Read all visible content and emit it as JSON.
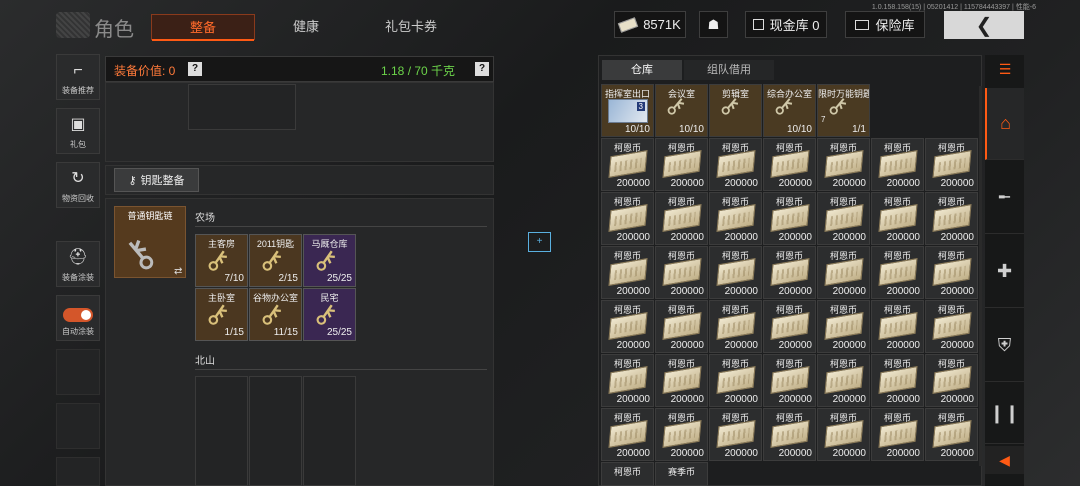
{
  "version": "1.0.158.158(15) | 05201412 | 115784443397 | 性能-6",
  "header": {
    "title": "角色",
    "tabs": [
      {
        "label": "整备",
        "active": true
      },
      {
        "label": "健康",
        "active": false
      },
      {
        "label": "礼包卡券",
        "active": false
      }
    ],
    "currency": "8571K",
    "cash_vault": "现金库 0",
    "safe_vault": "保险库",
    "back": "❮"
  },
  "left_nav": [
    {
      "label": "装备推荐",
      "icon": "gun-icon"
    },
    {
      "label": "礼包",
      "icon": "gift-icon"
    },
    {
      "label": "物资回收",
      "icon": "recycle-icon"
    },
    {
      "label": "装备涂装",
      "icon": "helmet-icon"
    },
    {
      "label": "自动涂装",
      "icon": "toggle-icon"
    }
  ],
  "loadout": {
    "value_label": "装备价值: 0",
    "weight": "1.18 / 70 千克",
    "help": "?",
    "key_button": "钥匙整备",
    "chain_label": "普通钥匙链",
    "swap": "⇄"
  },
  "farm": {
    "title": "农场",
    "keys": [
      {
        "name": "主客房",
        "count": "7/10",
        "tier": "gold"
      },
      {
        "name": "2011钥匙",
        "count": "2/15",
        "tier": "gold"
      },
      {
        "name": "马厩仓库",
        "count": "25/25",
        "tier": "purple"
      },
      {
        "name": "主卧室",
        "count": "1/15",
        "tier": "gold"
      },
      {
        "name": "谷物办公室",
        "count": "11/15",
        "tier": "gold"
      },
      {
        "name": "民宅",
        "count": "25/25",
        "tier": "purple"
      }
    ]
  },
  "north": {
    "title": "北山"
  },
  "storage": {
    "tabs": [
      {
        "label": "仓库",
        "active": true
      },
      {
        "label": "组队借用",
        "active": false
      }
    ],
    "top_items": [
      {
        "name": "指挥室出口",
        "count": "10/10",
        "kind": "card",
        "badge": "3"
      },
      {
        "name": "会议室",
        "count": "10/10",
        "kind": "key"
      },
      {
        "name": "剪辑室",
        "count": "",
        "kind": "key"
      },
      {
        "name": "综合办公室",
        "count": "10/10",
        "kind": "key"
      },
      {
        "name": "限时万能钥匙",
        "count": "1/1",
        "kind": "key",
        "sub": "7"
      }
    ],
    "money_name": "柯恩币",
    "money_count": "200000",
    "last_row": [
      "柯恩币",
      "赛季币"
    ]
  },
  "right_rail": [
    {
      "icon": "home-icon",
      "active": true
    },
    {
      "icon": "rifle-icon"
    },
    {
      "icon": "medkit-icon"
    },
    {
      "icon": "armor-icon"
    },
    {
      "icon": "ammo-icon"
    }
  ],
  "expand": "◀"
}
